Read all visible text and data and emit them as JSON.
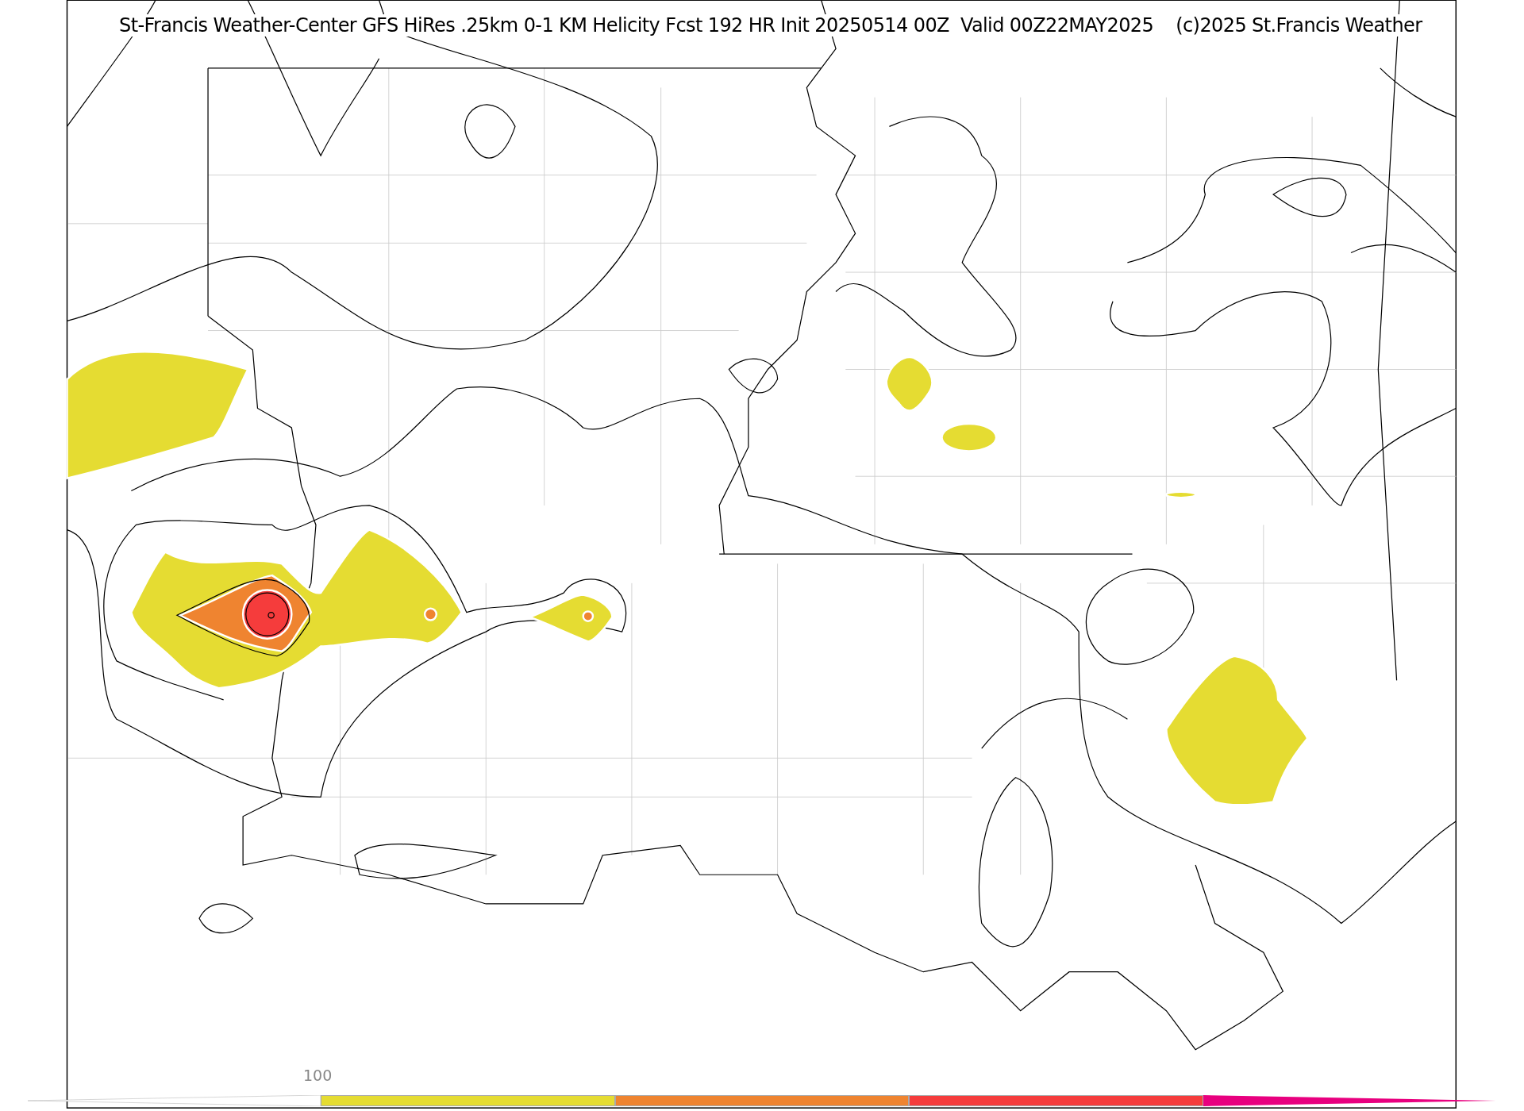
{
  "title": "St-Francis Weather-Center GFS HiRes .25km 0-1 KM Helicity Fcst 192 HR Init 20250514 00Z  Valid 00Z22MAY2025    (c)2025 St.Francis Weather",
  "colorbar": {
    "label": "100",
    "segments": [
      {
        "kind": "triangle-left",
        "color": "#ffffff"
      },
      {
        "kind": "bar",
        "color": "#e5dc32"
      },
      {
        "kind": "bar",
        "color": "#ef8430"
      },
      {
        "kind": "bar",
        "color": "#f53c3c"
      },
      {
        "kind": "triangle-right",
        "color": "#e8007f"
      }
    ]
  }
}
